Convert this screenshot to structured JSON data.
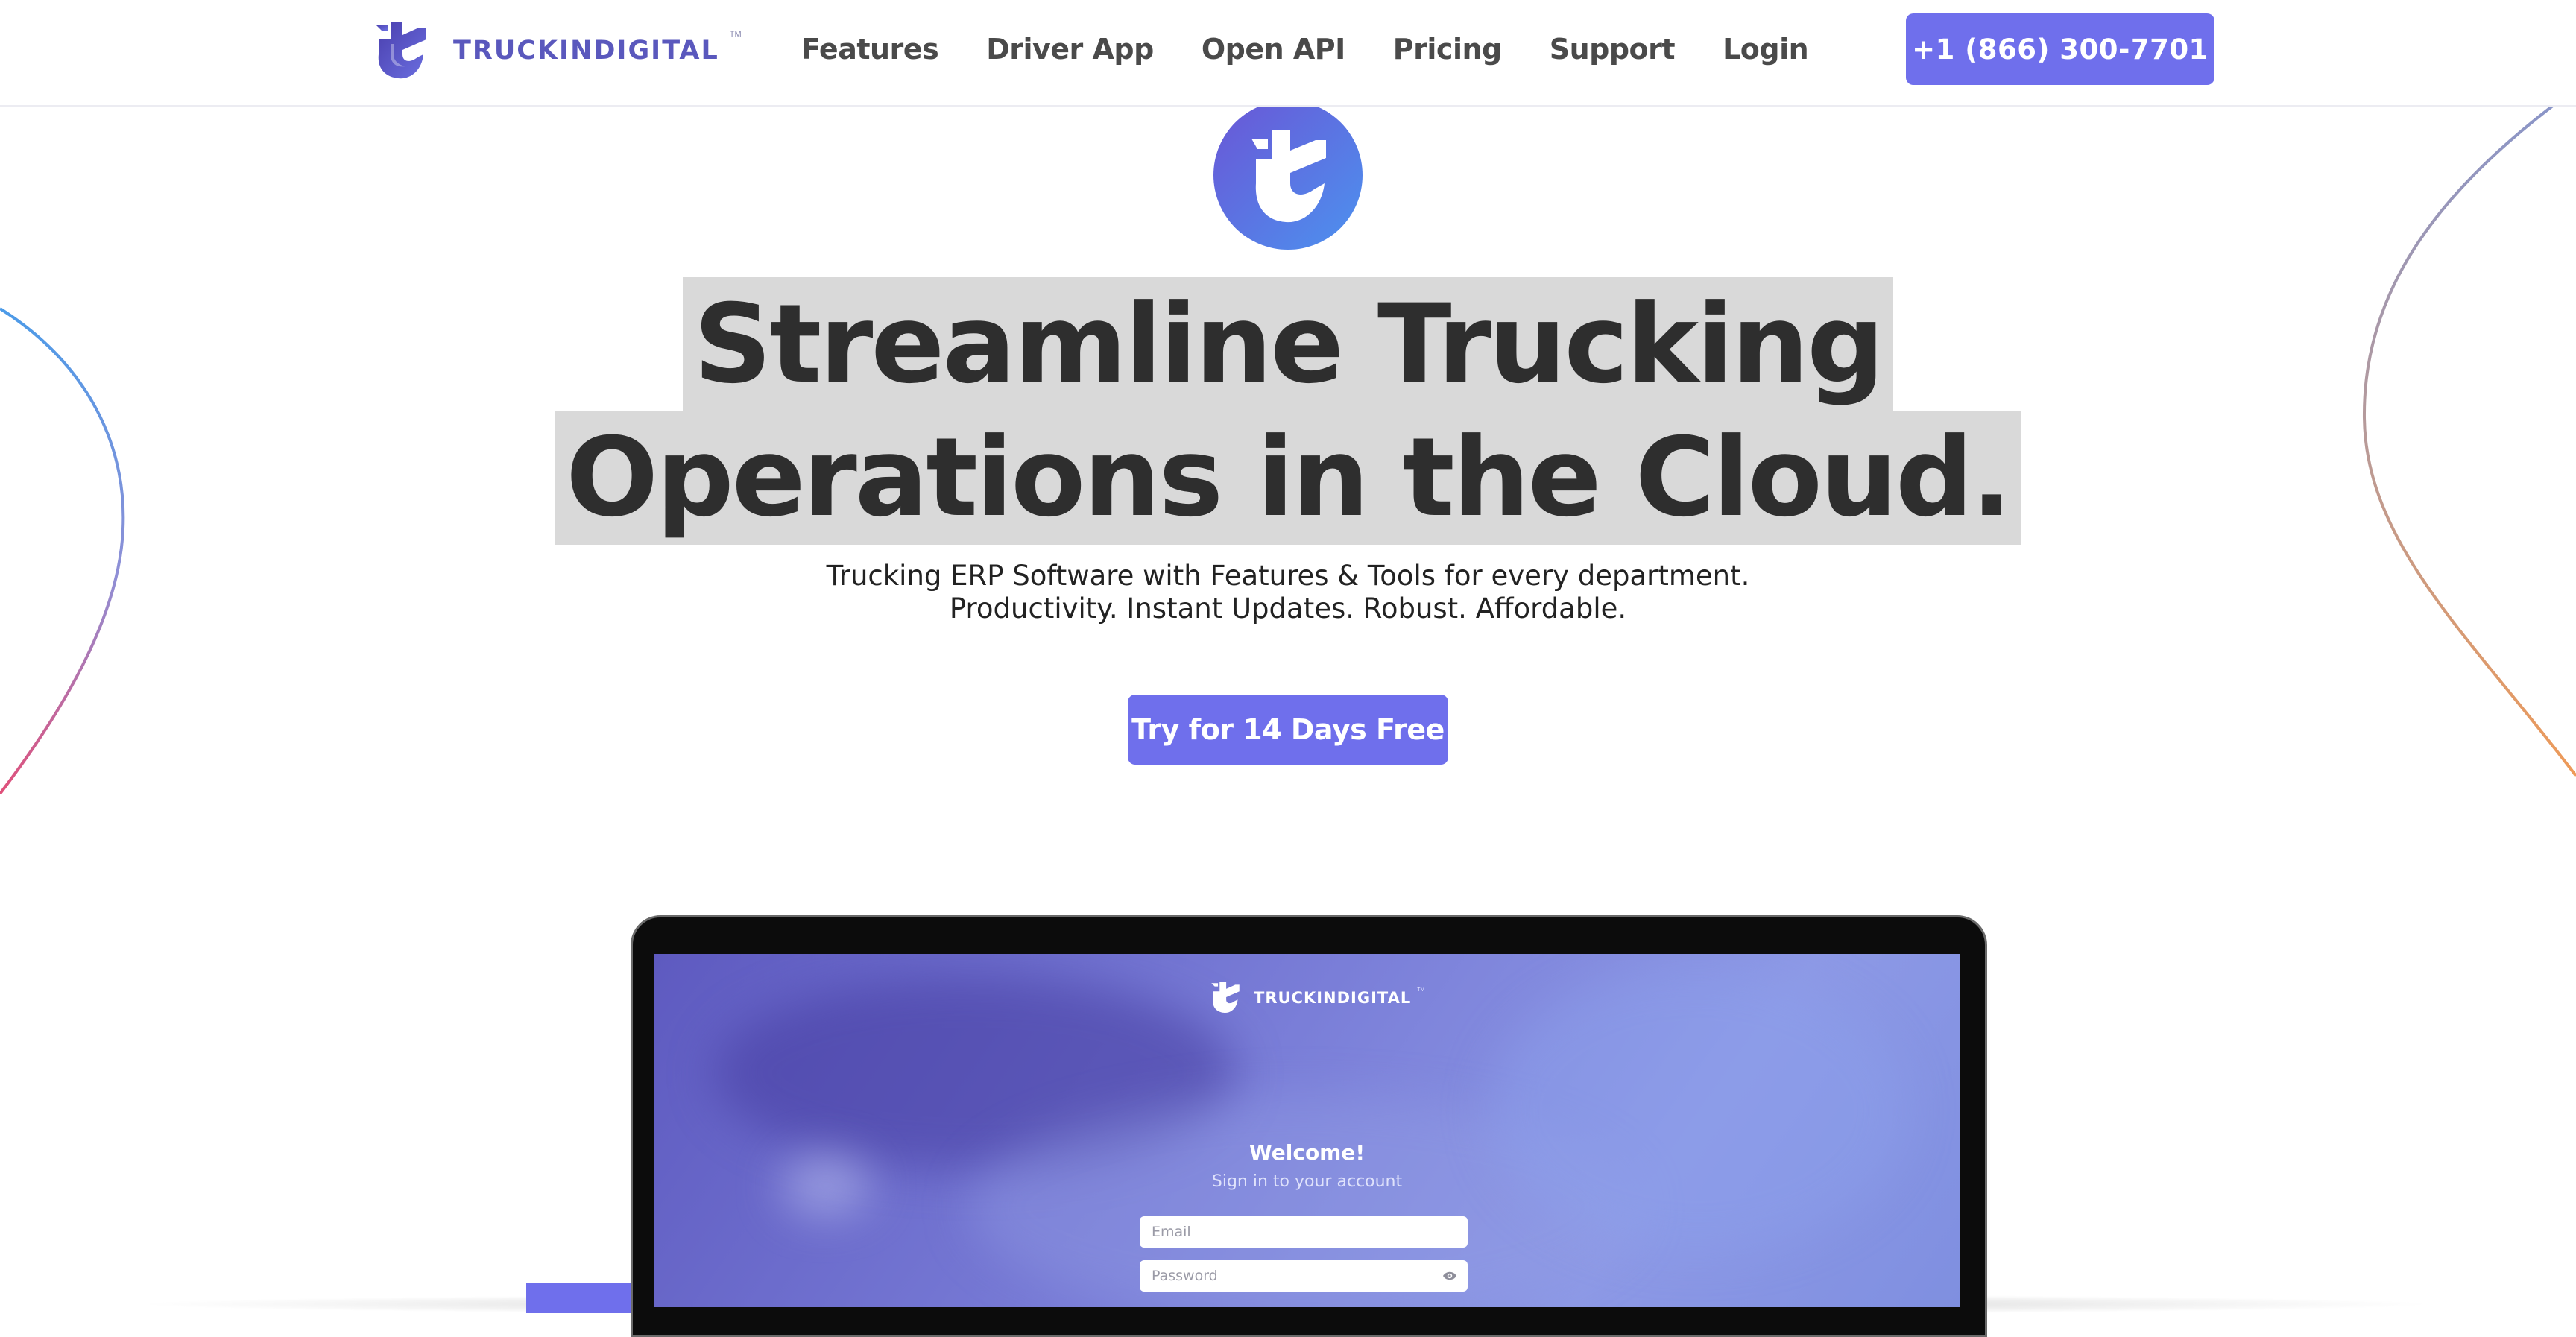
{
  "header": {
    "brand_name": "TRUCKINDIGITAL",
    "brand_tm": "TM",
    "nav": [
      "Features",
      "Driver App",
      "Open API",
      "Pricing",
      "Support",
      "Login"
    ],
    "phone": "+1 (866) 300-7701"
  },
  "hero": {
    "headline_line1": "Streamline Trucking",
    "headline_line2": "Operations in the Cloud.",
    "sub_line1": "Trucking ERP Software with Features & Tools for every department.",
    "sub_line2": "Productivity. Instant Updates. Robust. Affordable.",
    "cta_label": "Try for 14 Days Free"
  },
  "mockup": {
    "brand_name": "TRUCKINDIGITAL",
    "brand_tm": "TM",
    "welcome": "Welcome!",
    "subtitle": "Sign in to your account",
    "email_placeholder": "Email",
    "password_placeholder": "Password"
  },
  "colors": {
    "accent": "#6f6fec",
    "brand_text": "#5a58bd",
    "headline_highlight": "#d9d9d9"
  },
  "icons": {
    "brand": "truckindigital-logo-icon",
    "hero": "truckindigital-badge-icon",
    "password_toggle": "eye-icon"
  }
}
